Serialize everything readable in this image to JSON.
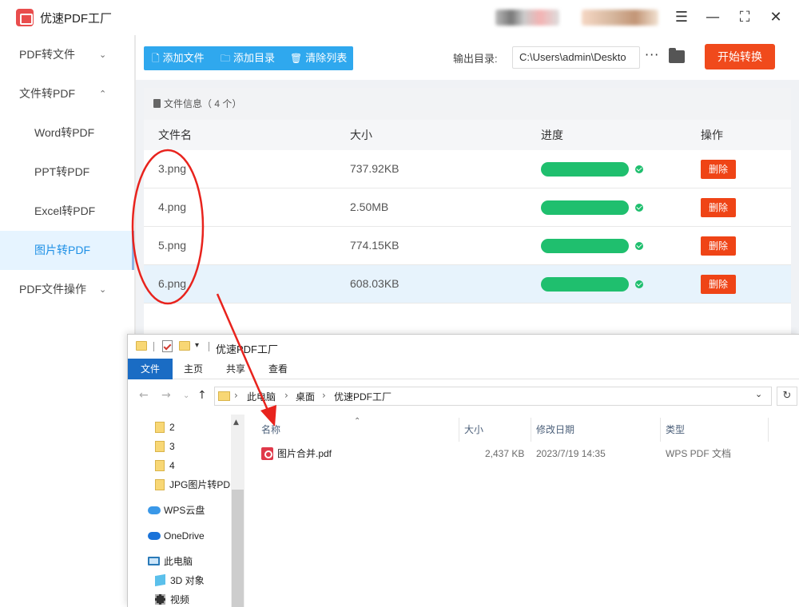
{
  "app": {
    "title": "优速PDF工厂",
    "window_controls": [
      "menu-icon",
      "minimize-icon",
      "maximize-icon",
      "close-icon"
    ]
  },
  "sidebar": {
    "items": [
      {
        "label": "PDF转文件",
        "icon": "chevron-down-icon"
      },
      {
        "label": "文件转PDF",
        "icon": "chevron-up-icon"
      },
      {
        "label": "Word转PDF"
      },
      {
        "label": "PPT转PDF"
      },
      {
        "label": "Excel转PDF"
      },
      {
        "label": "图片转PDF",
        "active": true
      },
      {
        "label": "PDF文件操作",
        "icon": "chevron-down-icon"
      }
    ]
  },
  "toolbar": {
    "add_file": "添加文件",
    "add_dir": "添加目录",
    "clear_list": "清除列表",
    "output_label": "输出目录:",
    "output_path": "C:\\Users\\admin\\Deskto",
    "more": "···",
    "start": "开始转换"
  },
  "file_list": {
    "info": "文件信息（ 4 个）",
    "headers": {
      "name": "文件名",
      "size": "大小",
      "progress": "进度",
      "action": "操作"
    },
    "rows": [
      {
        "name": "3.png",
        "size": "737.92KB",
        "progress": 1.0,
        "action": "删除"
      },
      {
        "name": "4.png",
        "size": "2.50MB",
        "progress": 1.0,
        "action": "删除"
      },
      {
        "name": "5.png",
        "size": "774.15KB",
        "progress": 1.0,
        "action": "删除"
      },
      {
        "name": "6.png",
        "size": "608.03KB",
        "progress": 1.0,
        "action": "删除"
      }
    ]
  },
  "explorer": {
    "title": "优速PDF工厂",
    "ribbon_tabs": [
      "文件",
      "主页",
      "共享",
      "查看"
    ],
    "breadcrumb": [
      "此电脑",
      "桌面",
      "优速PDF工厂"
    ],
    "nav_items": [
      "2",
      "3",
      "4",
      "JPG图片转PDF",
      "WPS云盘",
      "OneDrive",
      "此电脑",
      "3D 对象",
      "视频"
    ],
    "columns": {
      "name": "名称",
      "size": "大小",
      "date": "修改日期",
      "type": "类型"
    },
    "files": [
      {
        "name": "图片合并.pdf",
        "size": "2,437 KB",
        "date": "2023/7/19 14:35",
        "type": "WPS PDF 文档"
      }
    ]
  },
  "colors": {
    "accent_blue": "#2fa8ee",
    "start_button": "#f04a1c",
    "progress_green": "#1fbf6e",
    "delete_red": "#ef4416",
    "annotation_red": "#e8231d",
    "explorer_blue": "#1a6cc4"
  }
}
